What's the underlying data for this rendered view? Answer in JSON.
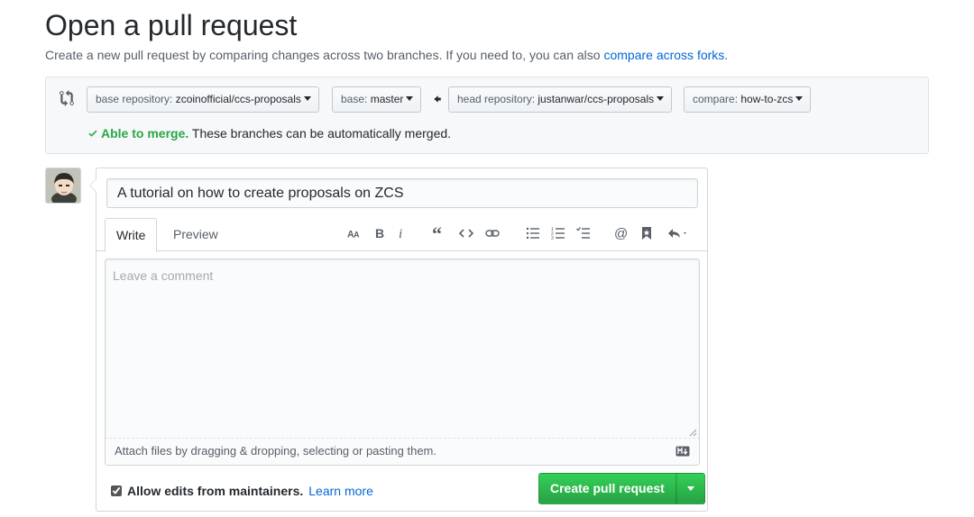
{
  "page": {
    "title": "Open a pull request",
    "subtitle_text": "Create a new pull request by comparing changes across two branches. If you need to, you can also ",
    "subtitle_link": "compare across forks."
  },
  "compare": {
    "base_repo_prefix": "base repository: ",
    "base_repo_value": "zcoinofficial/ccs-proposals",
    "base_prefix": "base: ",
    "base_value": "master",
    "head_repo_prefix": "head repository: ",
    "head_repo_value": "justanwar/ccs-proposals",
    "compare_prefix": "compare: ",
    "compare_value": "how-to-zcs",
    "merge_ok": "Able to merge.",
    "merge_text": " These branches can be automatically merged."
  },
  "form": {
    "title_value": "A tutorial on how to create proposals on ZCS",
    "tabs": [
      {
        "label": "Write",
        "active": true
      },
      {
        "label": "Preview",
        "active": false
      }
    ],
    "toolbar_icons": [
      "text-size-icon",
      "bold-icon",
      "italic-icon",
      "quote-icon",
      "code-icon",
      "link-icon",
      "bulleted-list-icon",
      "numbered-list-icon",
      "task-list-icon",
      "mention-icon",
      "reference-icon",
      "reply-icon"
    ],
    "comment_placeholder": "Leave a comment",
    "attach_text": "Attach files by dragging & dropping, selecting or pasting them.",
    "allow_edits_label": "Allow edits from maintainers.",
    "allow_edits_checked": true,
    "learn_more": "Learn more",
    "create_button": "Create pull request"
  },
  "colors": {
    "link": "#0366d6",
    "success": "#28a745",
    "border": "#d1d5da"
  }
}
